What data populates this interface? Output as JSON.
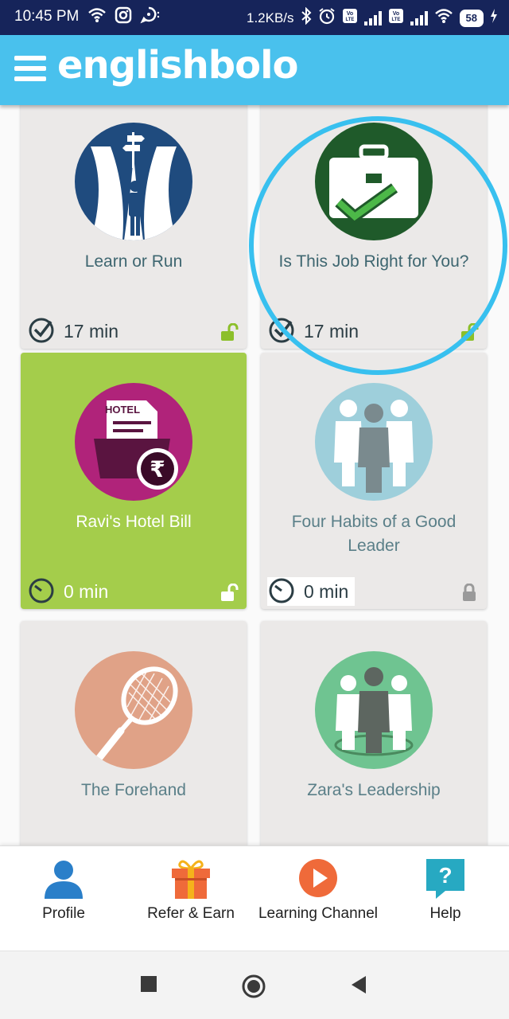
{
  "status_bar": {
    "time": "10:45 PM",
    "net_speed": "1.2KB/s",
    "battery": "58",
    "sim_tag": "LTE"
  },
  "header": {
    "app_name": "englishbolo"
  },
  "cards": [
    {
      "title": "Learn or Run",
      "duration": "17 min",
      "locked": false,
      "icon": "crossroads-icon",
      "circle_color": "#1f4b7e"
    },
    {
      "title": "Is This Job Right for You?",
      "duration": "17 min",
      "locked": false,
      "icon": "briefcase-check-icon",
      "circle_color": "#1f5a2a"
    },
    {
      "title": "Ravi's Hotel Bill",
      "duration": "0 min",
      "locked": false,
      "icon": "hotel-bill-icon",
      "circle_color": "#b0237a"
    },
    {
      "title": "Four Habits of a Good Leader",
      "duration": "0 min",
      "locked": true,
      "icon": "leader-group-icon",
      "circle_color": "#9ecfdb"
    },
    {
      "title": "The Forehand",
      "duration": "",
      "locked": false,
      "icon": "tennis-racket-icon",
      "circle_color": "#e0a287"
    },
    {
      "title": "Zara's Leadership",
      "duration": "",
      "locked": false,
      "icon": "team-leader-icon",
      "circle_color": "#6fc491"
    }
  ],
  "bottom_nav": {
    "items": [
      {
        "label": "Profile",
        "icon": "profile-icon",
        "color": "#2a7fc9"
      },
      {
        "label": "Refer & Earn",
        "icon": "gift-icon",
        "color": "#ef6a3a"
      },
      {
        "label": "Learning Channel",
        "icon": "play-icon",
        "color": "#ef6a3a"
      },
      {
        "label": "Help",
        "icon": "help-icon",
        "color": "#27a9c2"
      }
    ]
  },
  "colors": {
    "status_bar": "#16245a",
    "header": "#49c1ed",
    "card_bg": "#ebe9e8",
    "card_active": "#a4cd4b",
    "highlight_ring": "#38c0ef",
    "unlock_green": "#8cbf2a"
  }
}
